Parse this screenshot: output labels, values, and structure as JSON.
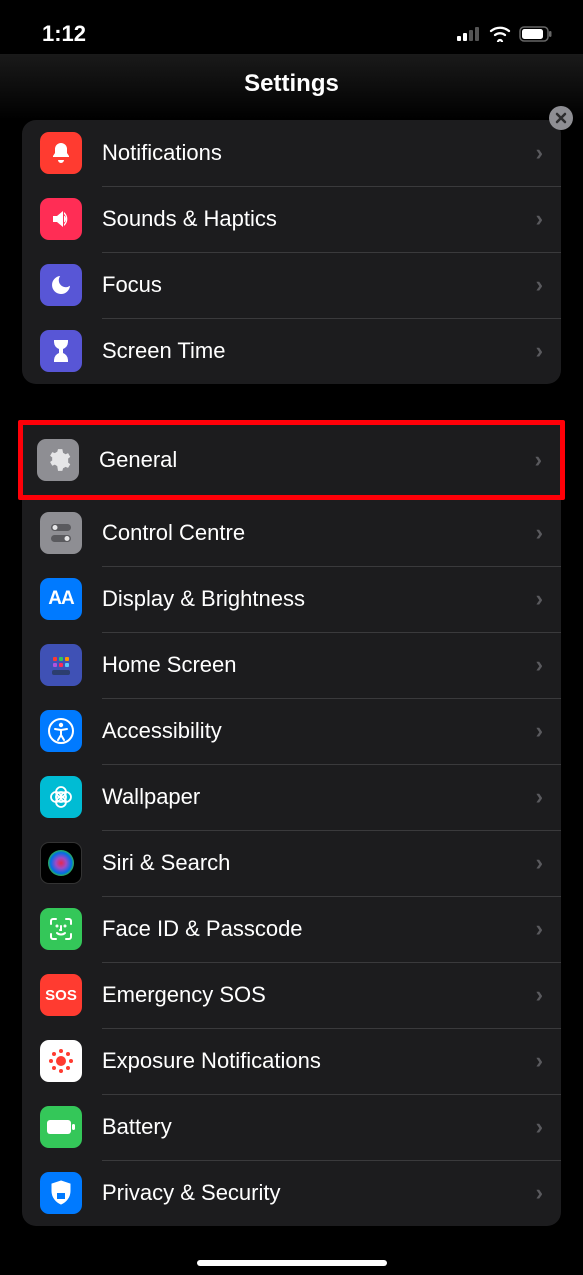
{
  "statusBar": {
    "time": "1:12"
  },
  "header": {
    "title": "Settings"
  },
  "group1": [
    {
      "label": "Notifications"
    },
    {
      "label": "Sounds & Haptics"
    },
    {
      "label": "Focus"
    },
    {
      "label": "Screen Time"
    }
  ],
  "highlighted": {
    "label": "General"
  },
  "group2": [
    {
      "label": "Control Centre"
    },
    {
      "label": "Display & Brightness"
    },
    {
      "label": "Home Screen"
    },
    {
      "label": "Accessibility"
    },
    {
      "label": "Wallpaper"
    },
    {
      "label": "Siri & Search"
    },
    {
      "label": "Face ID & Passcode"
    },
    {
      "label": "Emergency SOS"
    },
    {
      "label": "Exposure Notifications"
    },
    {
      "label": "Battery"
    },
    {
      "label": "Privacy & Security"
    }
  ]
}
